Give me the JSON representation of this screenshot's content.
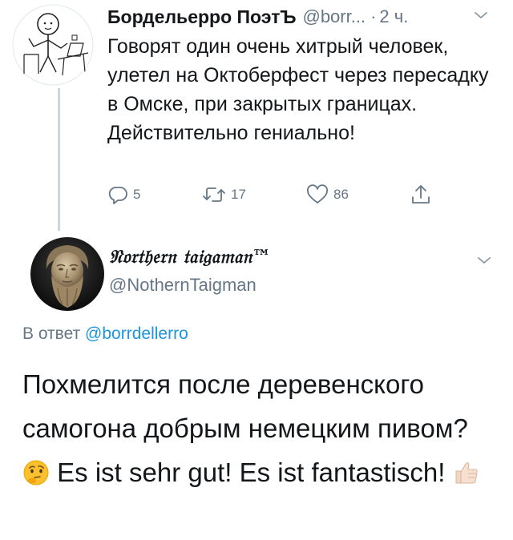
{
  "tweet1": {
    "author_name": "Бордельерро ПоэтЪ",
    "author_handle": "@borr...",
    "separator": "·",
    "time": "2 ч.",
    "text": "Говорят один очень хитрый человек, улетел на Октоберфест через пересадку в Омске, при закрытых границах. Действительно гениально!",
    "reply_count": "5",
    "retweet_count": "17",
    "like_count": "86",
    "icons": [
      "reply-icon",
      "retweet-icon",
      "like-icon",
      "share-icon",
      "chevron-down-icon"
    ]
  },
  "tweet2": {
    "author_name": "𝔑𝔬𝔯𝔱𝔥𝔢𝔯𝔫 𝔱𝔞𝔦𝔤𝔞𝔪𝔞𝔫™",
    "author_handle": "@NothernTaigman",
    "reply_prefix": "В ответ",
    "reply_to": "@borrdellerro",
    "text_part1": "Похмелится после деревенского самогона добрым немецким пивом?",
    "text_part2": "Es ist sehr gut! Es ist fantastisch!",
    "emojis": [
      "thinking-face-emoji",
      "thumbs-up-emoji"
    ]
  },
  "colors": {
    "text": "#14171a",
    "secondary": "#657786",
    "link": "#1b95e0",
    "thread_line": "#ccd6dd"
  }
}
